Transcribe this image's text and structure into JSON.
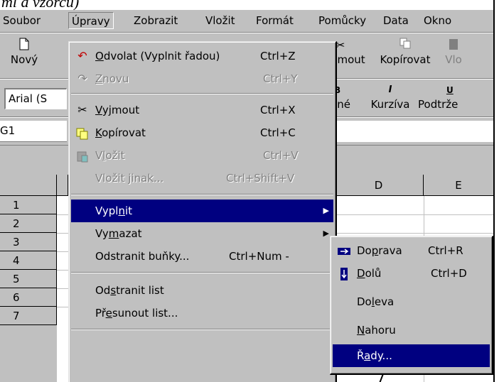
{
  "caption": "ml a vzorců)",
  "menubar": {
    "items": [
      "Soubor",
      "Úpravy",
      "Zobrazit",
      "Vložit",
      "Formát",
      "Pomůcky",
      "Data",
      "Okno"
    ]
  },
  "toolbar1": {
    "new_label": "Nový",
    "cut_label": "jmout",
    "copy_label": "Kopírovat",
    "paste_label": "Vlo"
  },
  "toolbar2": {
    "font_value": "Arial (S",
    "bold_label": "čné",
    "italic_label": "Kurzíva",
    "underline_label": "Podtrže"
  },
  "namebox": {
    "value": "G1"
  },
  "sheet": {
    "columns": [
      "D",
      "E"
    ],
    "rows": [
      "1",
      "2",
      "3",
      "4",
      "5",
      "6",
      "7"
    ]
  },
  "upravy_menu": {
    "undo": {
      "pre": "",
      "u": "O",
      "post": "dvolat (Vyplnit řadou)",
      "shortcut": "Ctrl+Z"
    },
    "redo": {
      "pre": "",
      "u": "Z",
      "post": "novu",
      "shortcut": "Ctrl+Y"
    },
    "cut": {
      "pre": "",
      "u": "V",
      "post": "yjmout",
      "shortcut": "Ctrl+X"
    },
    "copy": {
      "pre": "",
      "u": "K",
      "post": "opírovat",
      "shortcut": "Ctrl+C"
    },
    "paste": {
      "pre": "V",
      "u": "l",
      "post": "ožit",
      "shortcut": "Ctrl+V"
    },
    "paste_special": {
      "label": "Vložit jinak...",
      "shortcut": "Ctrl+Shift+V"
    },
    "fill": {
      "pre": "Vypl",
      "u": "n",
      "post": "it"
    },
    "clear": {
      "pre": "Vy",
      "u": "m",
      "post": "azat"
    },
    "delete_cells": {
      "label": "Odstranit buňky...",
      "shortcut": "Ctrl+Num -"
    },
    "delete_sheet": {
      "pre": "Od",
      "u": "s",
      "post": "tranit list"
    },
    "move_sheet": {
      "pre": "Př",
      "u": "e",
      "post": "sunout list..."
    }
  },
  "fill_menu": {
    "right": {
      "pre": "Do",
      "u": "p",
      "post": "rava",
      "shortcut": "Ctrl+R"
    },
    "down": {
      "pre": "",
      "u": "D",
      "post": "olů",
      "shortcut": "Ctrl+D"
    },
    "left": {
      "pre": "Do",
      "u": "l",
      "post": "eva"
    },
    "up": {
      "pre": "",
      "u": "N",
      "post": "ahoru"
    },
    "series": {
      "pre": "Ř",
      "u": "a",
      "post": "dy..."
    }
  }
}
